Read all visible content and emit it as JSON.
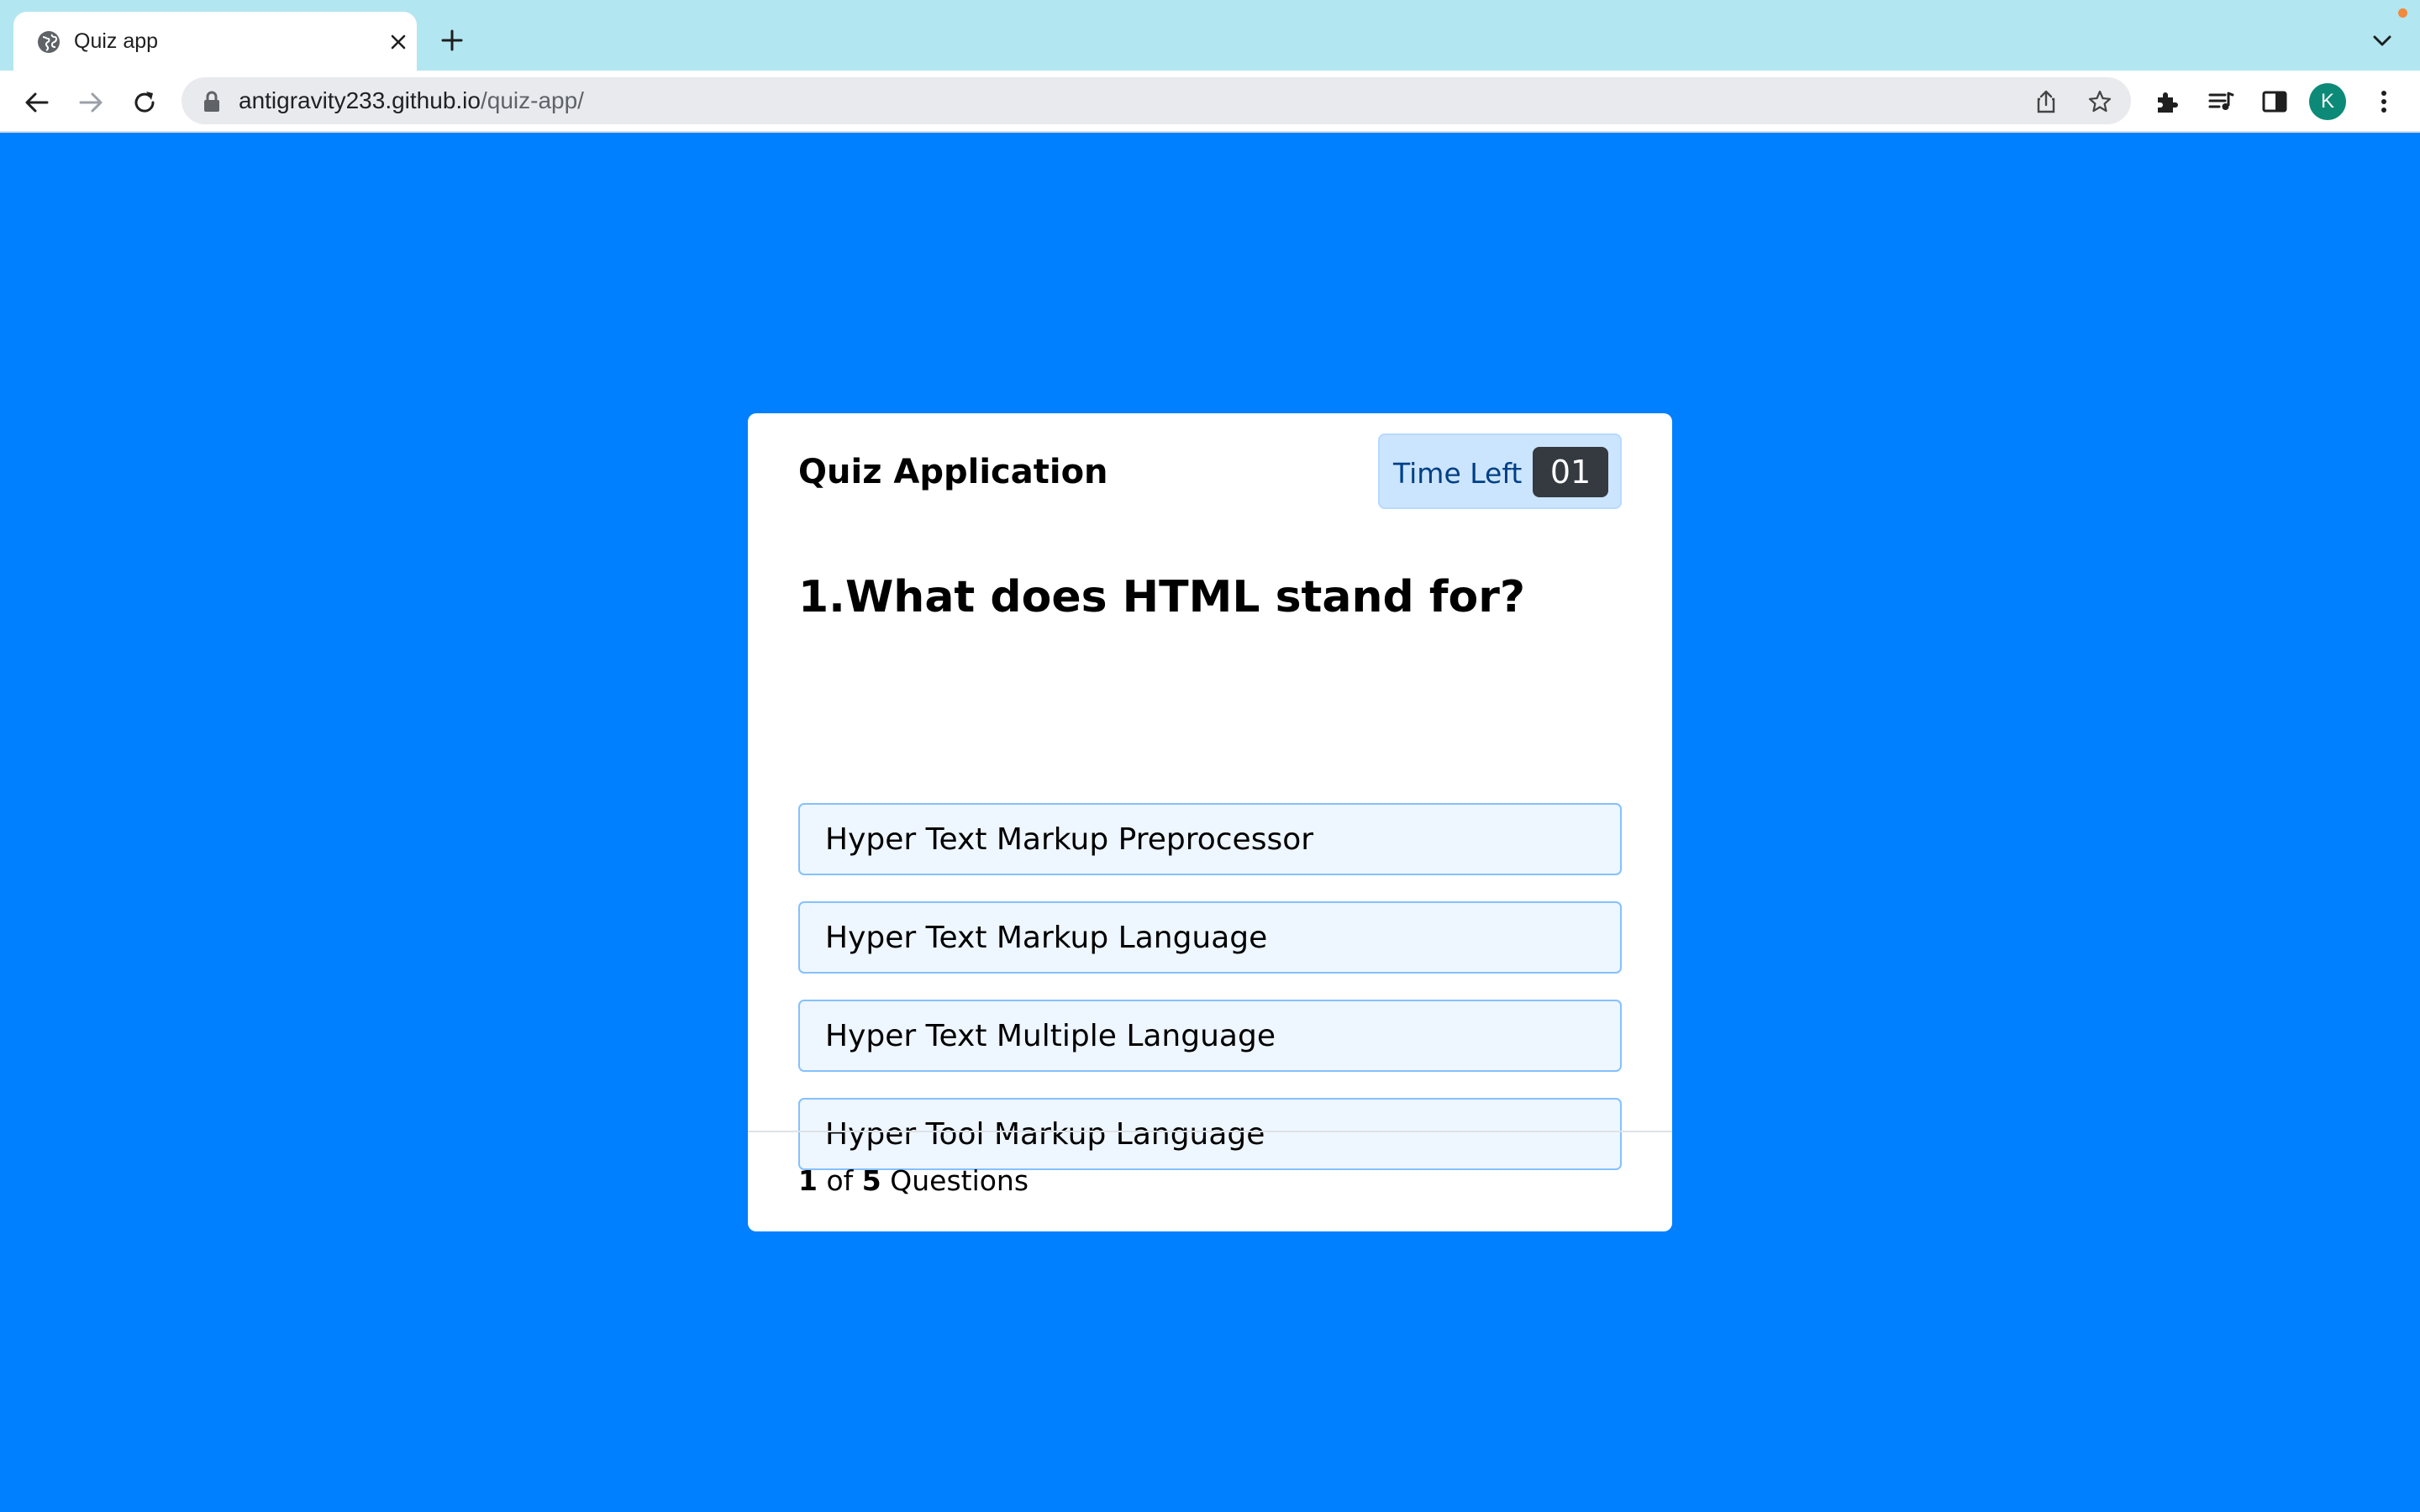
{
  "browser": {
    "tab": {
      "title": "Quiz app",
      "favicon": "globe-icon"
    },
    "address_bar": {
      "host": "antigravity233.github.io",
      "path": "/quiz-app/"
    },
    "profile_initial": "K",
    "colors": {
      "tabstrip": "#b2e6f1",
      "avatar": "#0c8a77"
    }
  },
  "quiz": {
    "title": "Quiz Application",
    "timer": {
      "label": "Time Left",
      "value": "01"
    },
    "question": {
      "number": "1.",
      "text": "What does HTML stand for?"
    },
    "options": [
      "Hyper Text Markup Preprocessor",
      "Hyper Text Markup Language",
      "Hyper Text Multiple Language",
      "Hyper Tool Markup Language"
    ],
    "footer": {
      "current": "1",
      "of_text": "of",
      "total": "5",
      "suffix": "Questions"
    },
    "colors": {
      "background": "#007fff",
      "card": "#ffffff",
      "option_bg": "#eef6ff",
      "option_border": "#84c1ff",
      "timer_bg": "#cce5ff",
      "timer_value_bg": "#343a40"
    }
  }
}
